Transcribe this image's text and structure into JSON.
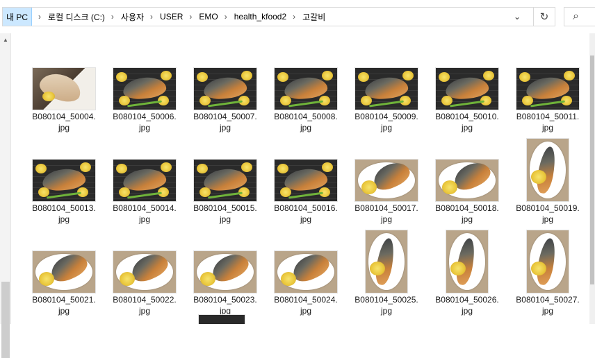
{
  "breadcrumb": {
    "items": [
      "내 PC",
      "로컬 디스크 (C:)",
      "사용자",
      "USER",
      "EMO",
      "health_kfood2",
      "고갈비"
    ],
    "separator": "›"
  },
  "icons": {
    "dropdown": "⌄",
    "refresh": "↻",
    "search": "⌕",
    "scroll_up": "▲"
  },
  "files": [
    {
      "name": "B080104_50004.",
      "ext": "jpg",
      "style": "white"
    },
    {
      "name": "B080104_50006.",
      "ext": "jpg",
      "style": "dark"
    },
    {
      "name": "B080104_50007.",
      "ext": "jpg",
      "style": "dark"
    },
    {
      "name": "B080104_50008.",
      "ext": "jpg",
      "style": "dark"
    },
    {
      "name": "B080104_50009.",
      "ext": "jpg",
      "style": "dark"
    },
    {
      "name": "B080104_50010.",
      "ext": "jpg",
      "style": "dark"
    },
    {
      "name": "B080104_50011.",
      "ext": "jpg",
      "style": "dark"
    },
    {
      "name": "B080104_50013.",
      "ext": "jpg",
      "style": "dark"
    },
    {
      "name": "B080104_50014.",
      "ext": "jpg",
      "style": "dark"
    },
    {
      "name": "B080104_50015.",
      "ext": "jpg",
      "style": "dark"
    },
    {
      "name": "B080104_50016.",
      "ext": "jpg",
      "style": "dark"
    },
    {
      "name": "B080104_50017.",
      "ext": "jpg",
      "style": "plate"
    },
    {
      "name": "B080104_50018.",
      "ext": "jpg",
      "style": "plate"
    },
    {
      "name": "B080104_50019.",
      "ext": "jpg",
      "style": "plate-portrait"
    },
    {
      "name": "B080104_50021.",
      "ext": "jpg",
      "style": "plate"
    },
    {
      "name": "B080104_50022.",
      "ext": "jpg",
      "style": "plate"
    },
    {
      "name": "B080104_50023.",
      "ext": "jpg",
      "style": "plate"
    },
    {
      "name": "B080104_50024.",
      "ext": "jpg",
      "style": "plate"
    },
    {
      "name": "B080104_50025.",
      "ext": "jpg",
      "style": "plate-portrait"
    },
    {
      "name": "B080104_50026.",
      "ext": "jpg",
      "style": "plate-portrait"
    },
    {
      "name": "B080104_50027.",
      "ext": "jpg",
      "style": "plate-portrait"
    }
  ]
}
